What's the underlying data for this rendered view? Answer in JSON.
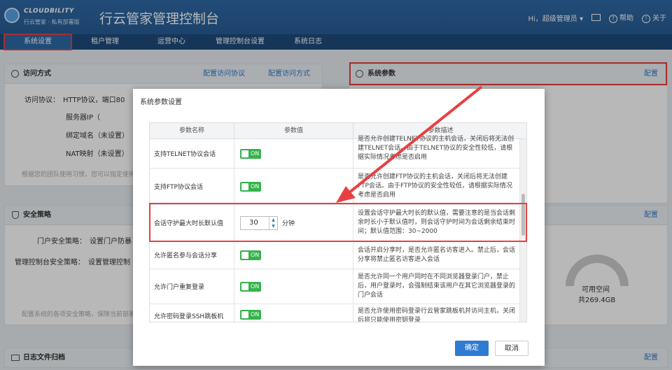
{
  "header": {
    "brand": "CLOUDBILITY",
    "brand_sub": "行云管家 · 私有部署版",
    "title": "行云管家管理控制台",
    "greeting": "Hi，超级管理员",
    "help": "帮助",
    "about": "关于"
  },
  "nav": [
    "系统设置",
    "租户管理",
    "运营中心",
    "管理控制台设置",
    "系统日志"
  ],
  "access_panel": {
    "title": "访问方式",
    "link1": "配置访问协议",
    "link2": "配置访问方式",
    "protocol": "访问协议：　HTTP协议，端口80",
    "server_ip": "服务器IP（　　　　　.）",
    "domain": "绑定域名（未设置）",
    "nat": "NAT映射（未设置）",
    "hint": "根据您的团队使用习惯，您可以指定使用"
  },
  "sys_panel": {
    "title": "系统参数",
    "config": "配置"
  },
  "security_panel": {
    "title": "安全策略",
    "config": "配置",
    "portal": "门户安全策略：　设置门户防暴",
    "console": "管理控制台安全策略：　设置管理控制",
    "hint": "配置系统的各项安全策略，保障当前部署"
  },
  "storage": {
    "label": "可用空间",
    "value": "共269.4GB"
  },
  "log_panel": {
    "title": "日志文件归档",
    "config": "配置"
  },
  "modal": {
    "title": "系统参数设置",
    "headers": [
      "参数名称",
      "参数值",
      "参数描述"
    ],
    "rows": [
      {
        "name": "支持TELNET协议会话",
        "desc": "是否允许创建TELNET协议的主机会话，关闭后将无法创建TELNET会话。由于TELNET协议的安全性较低，请根据实际情况考虑是否启用"
      },
      {
        "name": "支持FTP协议会话",
        "desc": "是否允许创建FTP协议的主机会话，关闭后将无法创建FTP会话。由于FTP协议的安全性较低，请根据实际情况考虑是否启用"
      },
      {
        "name": "会话守护最大时长默认值",
        "value": "30",
        "unit": "分钟",
        "desc": "设置会话守护最大时长的默认值，需要注意的是当会话剩余时长小于默认值时，则会话守护时间为会话剩余结束时间；默认值范围：30~2000"
      },
      {
        "name": "允许匿名参与会话分享",
        "desc": "会话开启分享时，是否允许匿名访客进入。禁止后，会话分享将禁止匿名访客进入会话"
      },
      {
        "name": "允许门户重复登录",
        "desc": "是否允许同一个用户同时在不同浏览器登录门户，禁止后，用户登录时，会强制结束该用户在其它浏览器登录的门户会话"
      },
      {
        "name": "允许密码登录SSH跳板机",
        "desc": "是否允许使用密码登录行云管家跳板机并访问主机，关闭后将只能使用密钥登录"
      }
    ],
    "toggle_label": "ON",
    "ok": "确定",
    "cancel": "取消"
  },
  "colors": {
    "accent": "#2f7bd1",
    "highlight": "#e84040",
    "toggle_on": "#37b24d",
    "header_bg": "#2f6aa6"
  }
}
